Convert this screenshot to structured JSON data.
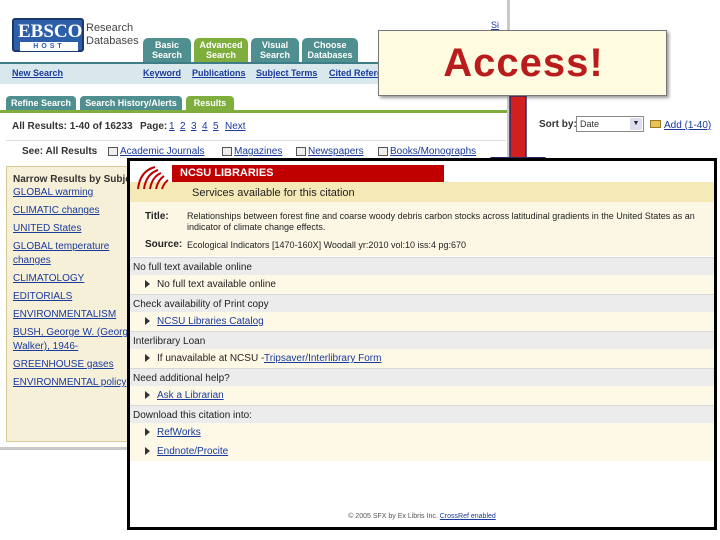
{
  "ebsco": {
    "logo": {
      "top": "EBSCO",
      "bottom": "HOST"
    },
    "brand_line1": "Research",
    "brand_line2": "Databases",
    "signin_partial": "Si",
    "top_tabs": [
      {
        "line1": "Basic",
        "line2": "Search"
      },
      {
        "line1": "Advanced",
        "line2": "Search"
      },
      {
        "line1": "Visual",
        "line2": "Search"
      },
      {
        "line1": "Choose",
        "line2": "Databases"
      }
    ],
    "nav": {
      "new_search": "New Search",
      "keyword": "Keyword",
      "publications": "Publications",
      "subject_terms": "Subject Terms",
      "cited_refs": "Cited Refere"
    },
    "sub_tabs": [
      "Refine Search",
      "Search History/Alerts",
      "Results"
    ],
    "results_label": "All Results: 1-40 of 16233",
    "page_label": "Page:",
    "pages": [
      "1",
      "2",
      "3",
      "4",
      "5"
    ],
    "next": "Next",
    "sort_label": "Sort by:",
    "sort_value": "Date",
    "add_link": "Add (1-40)",
    "see_label": "See: All Results",
    "pub_types": [
      "Academic Journals",
      "Magazines",
      "Newspapers",
      "Books/Monographs"
    ],
    "narrow_heading": "Narrow Results by Subje",
    "subjects": [
      "GLOBAL warming",
      "CLIMATIC changes",
      "UNITED States",
      "GLOBAL temperature",
      "changes",
      "CLIMATOLOGY",
      "EDITORIALS",
      "ENVIRONMENTALISM",
      "BUSH, George W. (George",
      "Walker), 1946-",
      "GREENHOUSE gases",
      "ENVIRONMENTAL policy"
    ]
  },
  "callout": {
    "text": "Access!",
    "color": "#b81c1c"
  },
  "sfx": {
    "brand": "NCSU LIBRARIES",
    "services_heading": "Services available for this citation",
    "title_label": "Title:",
    "title_value_1": "Relationships between forest fine and coarse woody debris carbon stocks across latitudinal gradients in the United States as an",
    "title_value_2": "indicator of climate change effects.",
    "source_label": "Source:",
    "source_value": "Ecological Indicators [1470-160X] Woodall yr:2010 vol:10 iss:4 pg:670",
    "sections": {
      "fulltext_head": "No full text available online",
      "fulltext_row": "No full text available online",
      "print_head": "Check availability of Print copy",
      "print_row": "NCSU Libraries Catalog",
      "ill_head": "Interlibrary Loan",
      "ill_row_prefix": "If unavailable at NCSU -",
      "ill_row_link": "Tripsaver/Interlibrary Form",
      "help_head": "Need additional help?",
      "help_row": "Ask a Librarian",
      "download_head": "Download this citation into:",
      "download_row_1": "RefWorks",
      "download_row_2": "Endnote/Procite"
    },
    "footer_text": "© 2005 SFX by Ex Libris Inc.",
    "footer_link": "CrossRef enabled"
  }
}
